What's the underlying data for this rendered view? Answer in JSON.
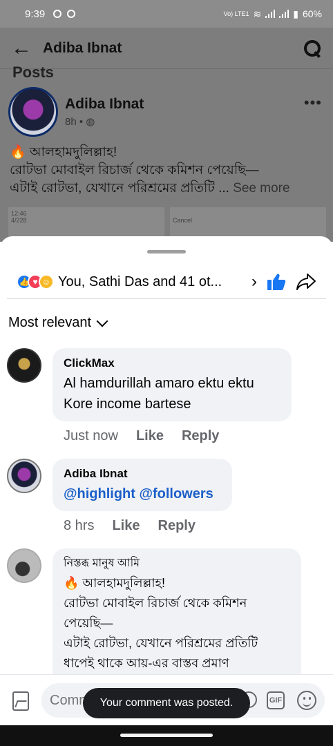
{
  "status_bar": {
    "time": "9:39",
    "network": "Vo) LTE1",
    "battery": "60%"
  },
  "header": {
    "title": "Adiba Ibnat"
  },
  "post": {
    "section_label": "Posts",
    "author": "Adiba Ibnat",
    "time": "8h •",
    "line1": "🔥 আলহামদুলিল্লাহ!",
    "line2": "রোটভা মোবাইল রিচার্জ থেকে কমিশন পেয়েছি—",
    "line3": "এটাই রোটভা, যেখানে পরিশ্রমের প্রতিটি ...",
    "see_more": "See more",
    "thumb_left": "4/228",
    "thumb_right": "Cancel",
    "thumb_time": "12:46"
  },
  "reactions": {
    "summary": "You, Sathi Das and 41 ot...",
    "icons": [
      "like",
      "love",
      "care"
    ]
  },
  "sort": {
    "label": "Most relevant"
  },
  "comments": [
    {
      "name": "ClickMax",
      "body_lines": [
        "Al hamdurillah amaro ektu ektu",
        "Kore income bartese"
      ],
      "time": "Just now",
      "like": "Like",
      "reply": "Reply"
    },
    {
      "name": "Adiba Ibnat",
      "body_lines": [
        "@highlight @followers"
      ],
      "time": "8 hrs",
      "like": "Like",
      "reply": "Reply"
    },
    {
      "name": "নিস্তব্ধ মানুষ আমি",
      "body_lines": [
        "🔥 আলহামদুলিল্লাহ!",
        "রোটভা মোবাইল রিচার্জ থেকে কমিশন",
        "পেয়েছি—",
        "এটাই রোটভা, যেখানে পরিশ্রমের প্রতিটি",
        "ধাপেই থাকে আয়-এর বাস্তব প্রমাণ"
      ]
    }
  ],
  "composer": {
    "placeholder": "Comm",
    "gif": "GIF"
  },
  "toast": {
    "text": "Your comment was posted."
  },
  "colors": {
    "accent": "#1877f2",
    "mention": "#1b5fc9",
    "bubble": "#f0f2f5",
    "muted": "#65676b"
  }
}
